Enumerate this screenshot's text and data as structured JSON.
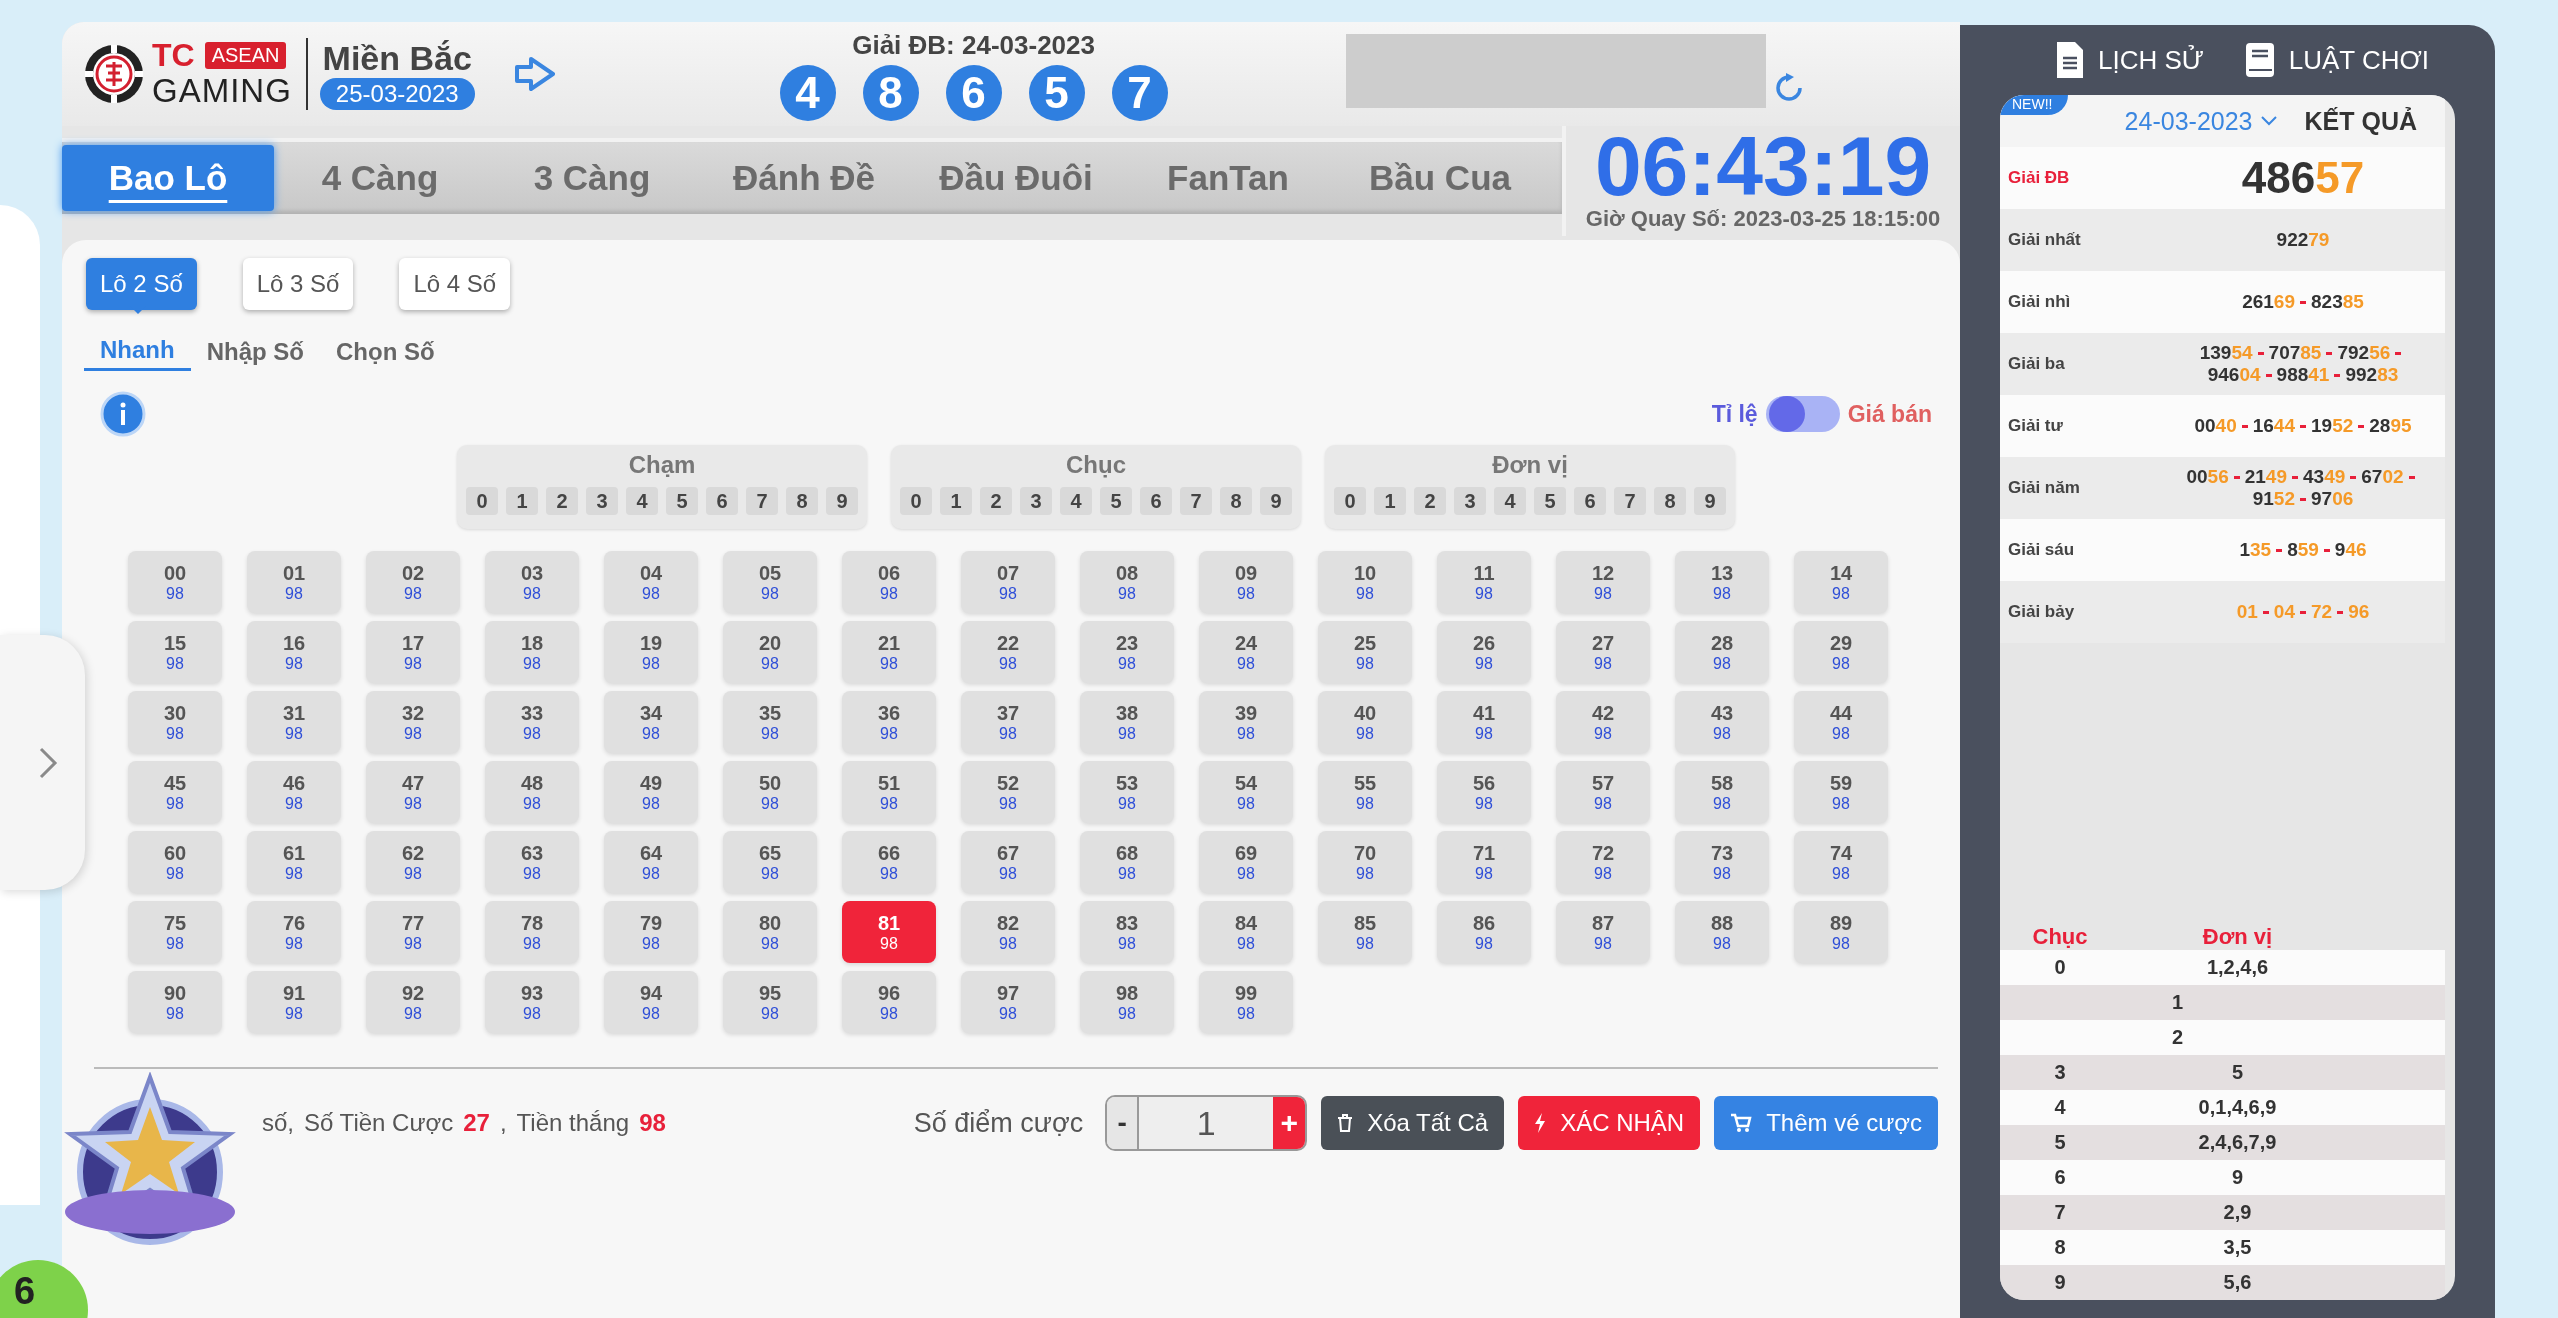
{
  "header": {
    "logo": {
      "brand": "TC",
      "badge": "ASEAN",
      "name": "GAMING"
    },
    "region": "Miền Bắc",
    "region_date": "25-03-2023",
    "draw_title": "Giải ĐB: 24-03-2023",
    "draw_balls": [
      "4",
      "8",
      "6",
      "5",
      "7"
    ]
  },
  "game_tabs": [
    {
      "label": "Bao Lô",
      "selected": true
    },
    {
      "label": "4 Càng",
      "selected": false
    },
    {
      "label": "3 Càng",
      "selected": false
    },
    {
      "label": "Đánh Đề",
      "selected": false
    },
    {
      "label": "Đầu Đuôi",
      "selected": false
    },
    {
      "label": "FanTan",
      "selected": false
    },
    {
      "label": "Bầu Cua",
      "selected": false
    }
  ],
  "countdown": {
    "time": "06:43:19",
    "draw_time": "Giờ Quay Số: 2023-03-25 18:15:00"
  },
  "bet_types": [
    {
      "label": "Lô 2 Số",
      "selected": true
    },
    {
      "label": "Lô 3 Số",
      "selected": false
    },
    {
      "label": "Lô 4 Số",
      "selected": false
    }
  ],
  "modes": [
    {
      "label": "Nhanh",
      "selected": true
    },
    {
      "label": "Nhập Số",
      "selected": false
    },
    {
      "label": "Chọn Số",
      "selected": false
    }
  ],
  "price_toggle": {
    "left_label": "Tỉ lệ",
    "right_label": "Giá bán",
    "on": false
  },
  "filters": [
    {
      "title": "Chạm",
      "digits": [
        "0",
        "1",
        "2",
        "3",
        "4",
        "5",
        "6",
        "7",
        "8",
        "9"
      ]
    },
    {
      "title": "Chục",
      "digits": [
        "0",
        "1",
        "2",
        "3",
        "4",
        "5",
        "6",
        "7",
        "8",
        "9"
      ]
    },
    {
      "title": "Đơn vị",
      "digits": [
        "0",
        "1",
        "2",
        "3",
        "4",
        "5",
        "6",
        "7",
        "8",
        "9"
      ]
    }
  ],
  "numbers": [
    {
      "number": "00",
      "odds": "98",
      "selected": false
    },
    {
      "number": "01",
      "odds": "98",
      "selected": false
    },
    {
      "number": "02",
      "odds": "98",
      "selected": false
    },
    {
      "number": "03",
      "odds": "98",
      "selected": false
    },
    {
      "number": "04",
      "odds": "98",
      "selected": false
    },
    {
      "number": "05",
      "odds": "98",
      "selected": false
    },
    {
      "number": "06",
      "odds": "98",
      "selected": false
    },
    {
      "number": "07",
      "odds": "98",
      "selected": false
    },
    {
      "number": "08",
      "odds": "98",
      "selected": false
    },
    {
      "number": "09",
      "odds": "98",
      "selected": false
    },
    {
      "number": "10",
      "odds": "98",
      "selected": false
    },
    {
      "number": "11",
      "odds": "98",
      "selected": false
    },
    {
      "number": "12",
      "odds": "98",
      "selected": false
    },
    {
      "number": "13",
      "odds": "98",
      "selected": false
    },
    {
      "number": "14",
      "odds": "98",
      "selected": false
    },
    {
      "number": "15",
      "odds": "98",
      "selected": false
    },
    {
      "number": "16",
      "odds": "98",
      "selected": false
    },
    {
      "number": "17",
      "odds": "98",
      "selected": false
    },
    {
      "number": "18",
      "odds": "98",
      "selected": false
    },
    {
      "number": "19",
      "odds": "98",
      "selected": false
    },
    {
      "number": "20",
      "odds": "98",
      "selected": false
    },
    {
      "number": "21",
      "odds": "98",
      "selected": false
    },
    {
      "number": "22",
      "odds": "98",
      "selected": false
    },
    {
      "number": "23",
      "odds": "98",
      "selected": false
    },
    {
      "number": "24",
      "odds": "98",
      "selected": false
    },
    {
      "number": "25",
      "odds": "98",
      "selected": false
    },
    {
      "number": "26",
      "odds": "98",
      "selected": false
    },
    {
      "number": "27",
      "odds": "98",
      "selected": false
    },
    {
      "number": "28",
      "odds": "98",
      "selected": false
    },
    {
      "number": "29",
      "odds": "98",
      "selected": false
    },
    {
      "number": "30",
      "odds": "98",
      "selected": false
    },
    {
      "number": "31",
      "odds": "98",
      "selected": false
    },
    {
      "number": "32",
      "odds": "98",
      "selected": false
    },
    {
      "number": "33",
      "odds": "98",
      "selected": false
    },
    {
      "number": "34",
      "odds": "98",
      "selected": false
    },
    {
      "number": "35",
      "odds": "98",
      "selected": false
    },
    {
      "number": "36",
      "odds": "98",
      "selected": false
    },
    {
      "number": "37",
      "odds": "98",
      "selected": false
    },
    {
      "number": "38",
      "odds": "98",
      "selected": false
    },
    {
      "number": "39",
      "odds": "98",
      "selected": false
    },
    {
      "number": "40",
      "odds": "98",
      "selected": false
    },
    {
      "number": "41",
      "odds": "98",
      "selected": false
    },
    {
      "number": "42",
      "odds": "98",
      "selected": false
    },
    {
      "number": "43",
      "odds": "98",
      "selected": false
    },
    {
      "number": "44",
      "odds": "98",
      "selected": false
    },
    {
      "number": "45",
      "odds": "98",
      "selected": false
    },
    {
      "number": "46",
      "odds": "98",
      "selected": false
    },
    {
      "number": "47",
      "odds": "98",
      "selected": false
    },
    {
      "number": "48",
      "odds": "98",
      "selected": false
    },
    {
      "number": "49",
      "odds": "98",
      "selected": false
    },
    {
      "number": "50",
      "odds": "98",
      "selected": false
    },
    {
      "number": "51",
      "odds": "98",
      "selected": false
    },
    {
      "number": "52",
      "odds": "98",
      "selected": false
    },
    {
      "number": "53",
      "odds": "98",
      "selected": false
    },
    {
      "number": "54",
      "odds": "98",
      "selected": false
    },
    {
      "number": "55",
      "odds": "98",
      "selected": false
    },
    {
      "number": "56",
      "odds": "98",
      "selected": false
    },
    {
      "number": "57",
      "odds": "98",
      "selected": false
    },
    {
      "number": "58",
      "odds": "98",
      "selected": false
    },
    {
      "number": "59",
      "odds": "98",
      "selected": false
    },
    {
      "number": "60",
      "odds": "98",
      "selected": false
    },
    {
      "number": "61",
      "odds": "98",
      "selected": false
    },
    {
      "number": "62",
      "odds": "98",
      "selected": false
    },
    {
      "number": "63",
      "odds": "98",
      "selected": false
    },
    {
      "number": "64",
      "odds": "98",
      "selected": false
    },
    {
      "number": "65",
      "odds": "98",
      "selected": false
    },
    {
      "number": "66",
      "odds": "98",
      "selected": false
    },
    {
      "number": "67",
      "odds": "98",
      "selected": false
    },
    {
      "number": "68",
      "odds": "98",
      "selected": false
    },
    {
      "number": "69",
      "odds": "98",
      "selected": false
    },
    {
      "number": "70",
      "odds": "98",
      "selected": false
    },
    {
      "number": "71",
      "odds": "98",
      "selected": false
    },
    {
      "number": "72",
      "odds": "98",
      "selected": false
    },
    {
      "number": "73",
      "odds": "98",
      "selected": false
    },
    {
      "number": "74",
      "odds": "98",
      "selected": false
    },
    {
      "number": "75",
      "odds": "98",
      "selected": false
    },
    {
      "number": "76",
      "odds": "98",
      "selected": false
    },
    {
      "number": "77",
      "odds": "98",
      "selected": false
    },
    {
      "number": "78",
      "odds": "98",
      "selected": false
    },
    {
      "number": "79",
      "odds": "98",
      "selected": false
    },
    {
      "number": "80",
      "odds": "98",
      "selected": false
    },
    {
      "number": "81",
      "odds": "98",
      "selected": true
    },
    {
      "number": "82",
      "odds": "98",
      "selected": false
    },
    {
      "number": "83",
      "odds": "98",
      "selected": false
    },
    {
      "number": "84",
      "odds": "98",
      "selected": false
    },
    {
      "number": "85",
      "odds": "98",
      "selected": false
    },
    {
      "number": "86",
      "odds": "98",
      "selected": false
    },
    {
      "number": "87",
      "odds": "98",
      "selected": false
    },
    {
      "number": "88",
      "odds": "98",
      "selected": false
    },
    {
      "number": "89",
      "odds": "98",
      "selected": false
    },
    {
      "number": "90",
      "odds": "98",
      "selected": false
    },
    {
      "number": "91",
      "odds": "98",
      "selected": false
    },
    {
      "number": "92",
      "odds": "98",
      "selected": false
    },
    {
      "number": "93",
      "odds": "98",
      "selected": false
    },
    {
      "number": "94",
      "odds": "98",
      "selected": false
    },
    {
      "number": "95",
      "odds": "98",
      "selected": false
    },
    {
      "number": "96",
      "odds": "98",
      "selected": false
    },
    {
      "number": "97",
      "odds": "98",
      "selected": false
    },
    {
      "number": "98",
      "odds": "98",
      "selected": false
    },
    {
      "number": "99",
      "odds": "98",
      "selected": false
    }
  ],
  "bet_summary": {
    "lead": "số,",
    "stake_label": "Số Tiền Cược",
    "stake": "27",
    "separator": ",",
    "win_label": "Tiền thắng",
    "win": "98"
  },
  "points": {
    "label": "Số điểm cược",
    "minus": "-",
    "value": "1",
    "plus": "+"
  },
  "actions": [
    {
      "kind": "clear",
      "label": "Xóa Tất Cả"
    },
    {
      "kind": "confirm",
      "label": "XÁC NHẬN"
    },
    {
      "kind": "add",
      "label": "Thêm vé cược"
    }
  ],
  "mini_game_ball": "6",
  "results_panel": {
    "links": [
      {
        "kind": "history",
        "label": "LỊCH SỬ"
      },
      {
        "kind": "rules",
        "label": "LUẬT CHƠI"
      }
    ],
    "badge": "NEW!!",
    "date": "24-03-2023",
    "title": "KẾT QUẢ",
    "prizes": [
      {
        "kind": "special",
        "label": "Giải ĐB",
        "numbers": [
          {
            "head": "486",
            "tail": "57"
          }
        ]
      },
      {
        "kind": "normal",
        "label": "Giải nhất",
        "numbers": [
          {
            "head": "922",
            "tail": "79"
          }
        ]
      },
      {
        "kind": "normal",
        "label": "Giải nhì",
        "numbers": [
          {
            "head": "261",
            "tail": "69"
          },
          {
            "head": "823",
            "tail": "85"
          }
        ]
      },
      {
        "kind": "normal",
        "label": "Giải ba",
        "numbers": [
          {
            "head": "139",
            "tail": "54"
          },
          {
            "head": "707",
            "tail": "85"
          },
          {
            "head": "792",
            "tail": "56"
          },
          {
            "head": "946",
            "tail": "04"
          },
          {
            "head": "988",
            "tail": "41"
          },
          {
            "head": "992",
            "tail": "83"
          }
        ]
      },
      {
        "kind": "normal",
        "label": "Giải tư",
        "numbers": [
          {
            "head": "00",
            "tail": "40"
          },
          {
            "head": "16",
            "tail": "44"
          },
          {
            "head": "19",
            "tail": "52"
          },
          {
            "head": "28",
            "tail": "95"
          }
        ]
      },
      {
        "kind": "normal",
        "label": "Giải năm",
        "numbers": [
          {
            "head": "00",
            "tail": "56"
          },
          {
            "head": "21",
            "tail": "49"
          },
          {
            "head": "43",
            "tail": "49"
          },
          {
            "head": "67",
            "tail": "02"
          },
          {
            "head": "91",
            "tail": "52"
          },
          {
            "head": "97",
            "tail": "06"
          }
        ]
      },
      {
        "kind": "normal",
        "label": "Giải sáu",
        "numbers": [
          {
            "head": "1",
            "tail": "35"
          },
          {
            "head": "8",
            "tail": "59"
          },
          {
            "head": "9",
            "tail": "46"
          }
        ]
      },
      {
        "kind": "normal",
        "label": "Giải bảy",
        "numbers": [
          {
            "tail": "01"
          },
          {
            "tail": "04"
          },
          {
            "tail": "72"
          },
          {
            "tail": "96"
          }
        ]
      }
    ],
    "head_tail": {
      "columns": [
        "Chục",
        "Đơn vị"
      ],
      "rows": [
        [
          "0",
          "1,2,4,6"
        ],
        [
          "1"
        ],
        [
          "2"
        ],
        [
          "3",
          "5"
        ],
        [
          "4",
          "0,1,4,6,9"
        ],
        [
          "5",
          "2,4,6,7,9"
        ],
        [
          "6",
          "9"
        ],
        [
          "7",
          "2,9"
        ],
        [
          "8",
          "3,5"
        ],
        [
          "9",
          "5,6"
        ]
      ]
    }
  }
}
